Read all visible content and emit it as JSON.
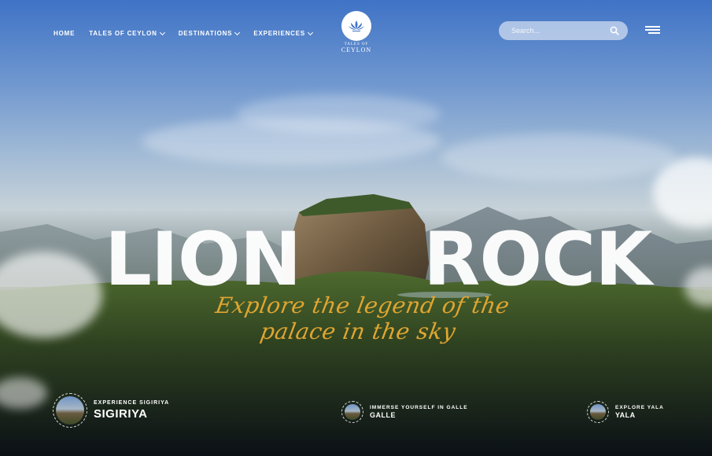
{
  "nav": {
    "items": [
      {
        "label": "HOME",
        "dropdown": false
      },
      {
        "label": "TALES OF CEYLON",
        "dropdown": true
      },
      {
        "label": "DESTINATIONS",
        "dropdown": true
      },
      {
        "label": "EXPERIENCES",
        "dropdown": true
      }
    ]
  },
  "logo": {
    "small": "TALES OF",
    "big": "CEYLON",
    "icon": "lotus-icon"
  },
  "search": {
    "placeholder": "Search...",
    "icon": "search-icon"
  },
  "menu": {
    "icon": "hamburger-menu-icon"
  },
  "hero": {
    "word1": "LION",
    "word2": "ROCK",
    "tagline": "Explore the legend of the palace in the sky"
  },
  "destinations": [
    {
      "subtitle": "EXPERIENCE SIGIRIYA",
      "title": "SIGIRIYA"
    },
    {
      "subtitle": "IMMERSE YOURSELF IN GALLE",
      "title": "GALLE"
    },
    {
      "subtitle": "EXPLORE YALA",
      "title": "YALA"
    }
  ],
  "colors": {
    "accent": "#e0a530",
    "sky": "#3f73c6"
  }
}
